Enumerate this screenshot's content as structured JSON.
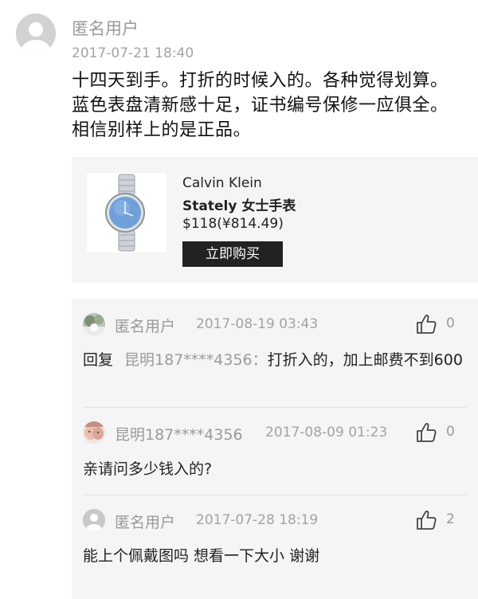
{
  "post": {
    "author": "匿名用户",
    "time": "2017-07-21 18:40",
    "body": "十四天到手。打折的时候入的。各种觉得划算。蓝色表盘清新感十足，证书编号保修一应俱全。相信别样上的是正品。"
  },
  "product": {
    "brand": "Calvin Klein",
    "name": "Stately 女士手表",
    "price": "$118(¥814.49)",
    "buy_label": "立即购买"
  },
  "replies": [
    {
      "author": "匿名用户",
      "time": "2017-08-19 03:43",
      "likes": "0",
      "reply_prefix": "回复",
      "reply_to": "昆明187****4356",
      "reply_sep": "：",
      "text": "打折入的，加上邮费不到600"
    },
    {
      "author": "昆明187****4356",
      "time": "2017-08-09 01:23",
      "likes": "0",
      "text": "亲请问多少钱入的?"
    },
    {
      "author": "匿名用户",
      "time": "2017-07-28 18:19",
      "likes": "2",
      "text": "能上个佩戴图吗 想看一下大小 谢谢"
    }
  ],
  "icons": {
    "post_avatar": "user-avatar-icon",
    "like": "thumbs-up-icon",
    "product_image": "wristwatch-image"
  },
  "colors": {
    "muted_text": "#9a9a9a",
    "panel_bg": "#f5f5f5",
    "button_bg": "#222222"
  }
}
